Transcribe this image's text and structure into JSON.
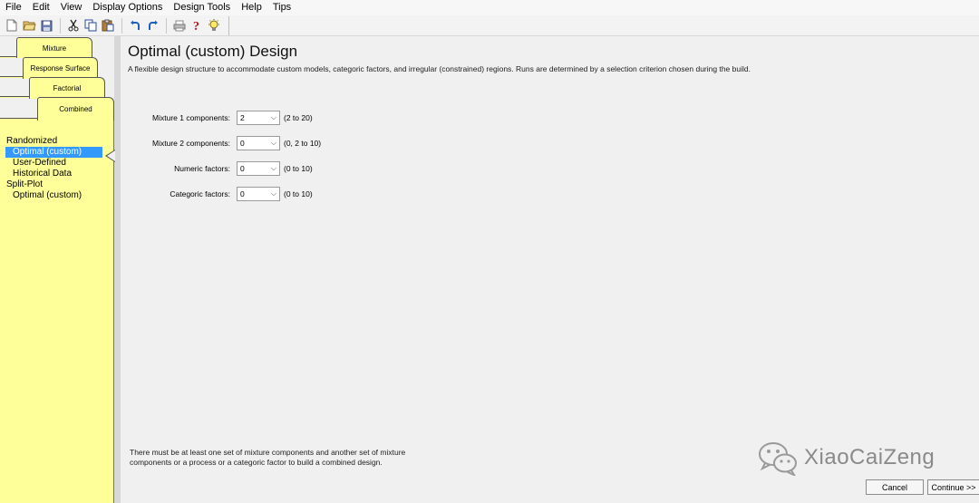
{
  "menu": [
    "File",
    "Edit",
    "View",
    "Display Options",
    "Design Tools",
    "Help",
    "Tips"
  ],
  "toolbar": {
    "icons": [
      "new-file-icon",
      "open-folder-icon",
      "save-icon",
      "cut-icon",
      "copy-icon",
      "paste-icon",
      "undo-icon",
      "redo-icon",
      "print-icon",
      "help-icon",
      "tip-bulb-icon"
    ]
  },
  "tabs": {
    "mixture": "Mixture",
    "response_surface": "Response Surface",
    "factorial": "Factorial",
    "combined": "Combined"
  },
  "nav": {
    "randomized": "Randomized",
    "optimal_custom": "Optimal (custom)",
    "user_defined": "User-Defined",
    "historical_data": "Historical Data",
    "split_plot": "Split-Plot",
    "split_optimal_custom": "Optimal (custom)"
  },
  "main": {
    "title": "Optimal (custom) Design",
    "description": "A flexible design structure to accommodate custom models, categoric factors, and irregular (constrained) regions. Runs are determined by a selection criterion chosen during the build.",
    "fields": [
      {
        "label": "Mixture 1 components:",
        "value": "2",
        "range": "(2 to 20)"
      },
      {
        "label": "Mixture 2 components:",
        "value": "0",
        "range": "(0, 2 to 10)"
      },
      {
        "label": "Numeric factors:",
        "value": "0",
        "range": "(0 to 10)"
      },
      {
        "label": "Categoric factors:",
        "value": "0",
        "range": "(0 to 10)"
      }
    ],
    "note": "There must be at least one set of mixture components and another set of mixture components or a process or a categoric factor to build a combined design."
  },
  "watermark": "XiaoCaiZeng",
  "buttons": {
    "cancel": "Cancel",
    "continue": "Continue >>"
  },
  "colors": {
    "nav_background": "#ffff99",
    "selection": "#3399ff"
  }
}
